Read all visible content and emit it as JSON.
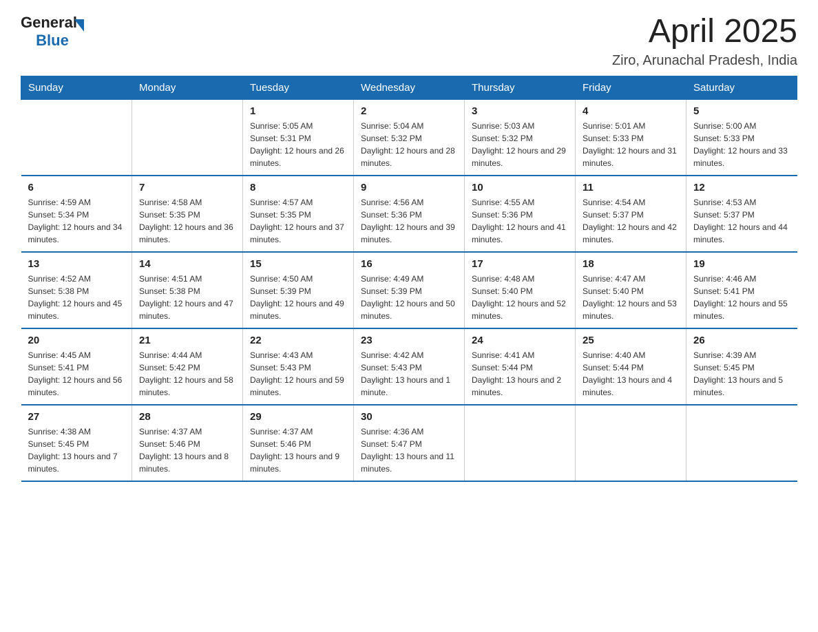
{
  "logo": {
    "general": "General",
    "blue": "Blue"
  },
  "title": "April 2025",
  "subtitle": "Ziro, Arunachal Pradesh, India",
  "days_header": [
    "Sunday",
    "Monday",
    "Tuesday",
    "Wednesday",
    "Thursday",
    "Friday",
    "Saturday"
  ],
  "weeks": [
    [
      {
        "day": "",
        "sunrise": "",
        "sunset": "",
        "daylight": ""
      },
      {
        "day": "",
        "sunrise": "",
        "sunset": "",
        "daylight": ""
      },
      {
        "day": "1",
        "sunrise": "Sunrise: 5:05 AM",
        "sunset": "Sunset: 5:31 PM",
        "daylight": "Daylight: 12 hours and 26 minutes."
      },
      {
        "day": "2",
        "sunrise": "Sunrise: 5:04 AM",
        "sunset": "Sunset: 5:32 PM",
        "daylight": "Daylight: 12 hours and 28 minutes."
      },
      {
        "day": "3",
        "sunrise": "Sunrise: 5:03 AM",
        "sunset": "Sunset: 5:32 PM",
        "daylight": "Daylight: 12 hours and 29 minutes."
      },
      {
        "day": "4",
        "sunrise": "Sunrise: 5:01 AM",
        "sunset": "Sunset: 5:33 PM",
        "daylight": "Daylight: 12 hours and 31 minutes."
      },
      {
        "day": "5",
        "sunrise": "Sunrise: 5:00 AM",
        "sunset": "Sunset: 5:33 PM",
        "daylight": "Daylight: 12 hours and 33 minutes."
      }
    ],
    [
      {
        "day": "6",
        "sunrise": "Sunrise: 4:59 AM",
        "sunset": "Sunset: 5:34 PM",
        "daylight": "Daylight: 12 hours and 34 minutes."
      },
      {
        "day": "7",
        "sunrise": "Sunrise: 4:58 AM",
        "sunset": "Sunset: 5:35 PM",
        "daylight": "Daylight: 12 hours and 36 minutes."
      },
      {
        "day": "8",
        "sunrise": "Sunrise: 4:57 AM",
        "sunset": "Sunset: 5:35 PM",
        "daylight": "Daylight: 12 hours and 37 minutes."
      },
      {
        "day": "9",
        "sunrise": "Sunrise: 4:56 AM",
        "sunset": "Sunset: 5:36 PM",
        "daylight": "Daylight: 12 hours and 39 minutes."
      },
      {
        "day": "10",
        "sunrise": "Sunrise: 4:55 AM",
        "sunset": "Sunset: 5:36 PM",
        "daylight": "Daylight: 12 hours and 41 minutes."
      },
      {
        "day": "11",
        "sunrise": "Sunrise: 4:54 AM",
        "sunset": "Sunset: 5:37 PM",
        "daylight": "Daylight: 12 hours and 42 minutes."
      },
      {
        "day": "12",
        "sunrise": "Sunrise: 4:53 AM",
        "sunset": "Sunset: 5:37 PM",
        "daylight": "Daylight: 12 hours and 44 minutes."
      }
    ],
    [
      {
        "day": "13",
        "sunrise": "Sunrise: 4:52 AM",
        "sunset": "Sunset: 5:38 PM",
        "daylight": "Daylight: 12 hours and 45 minutes."
      },
      {
        "day": "14",
        "sunrise": "Sunrise: 4:51 AM",
        "sunset": "Sunset: 5:38 PM",
        "daylight": "Daylight: 12 hours and 47 minutes."
      },
      {
        "day": "15",
        "sunrise": "Sunrise: 4:50 AM",
        "sunset": "Sunset: 5:39 PM",
        "daylight": "Daylight: 12 hours and 49 minutes."
      },
      {
        "day": "16",
        "sunrise": "Sunrise: 4:49 AM",
        "sunset": "Sunset: 5:39 PM",
        "daylight": "Daylight: 12 hours and 50 minutes."
      },
      {
        "day": "17",
        "sunrise": "Sunrise: 4:48 AM",
        "sunset": "Sunset: 5:40 PM",
        "daylight": "Daylight: 12 hours and 52 minutes."
      },
      {
        "day": "18",
        "sunrise": "Sunrise: 4:47 AM",
        "sunset": "Sunset: 5:40 PM",
        "daylight": "Daylight: 12 hours and 53 minutes."
      },
      {
        "day": "19",
        "sunrise": "Sunrise: 4:46 AM",
        "sunset": "Sunset: 5:41 PM",
        "daylight": "Daylight: 12 hours and 55 minutes."
      }
    ],
    [
      {
        "day": "20",
        "sunrise": "Sunrise: 4:45 AM",
        "sunset": "Sunset: 5:41 PM",
        "daylight": "Daylight: 12 hours and 56 minutes."
      },
      {
        "day": "21",
        "sunrise": "Sunrise: 4:44 AM",
        "sunset": "Sunset: 5:42 PM",
        "daylight": "Daylight: 12 hours and 58 minutes."
      },
      {
        "day": "22",
        "sunrise": "Sunrise: 4:43 AM",
        "sunset": "Sunset: 5:43 PM",
        "daylight": "Daylight: 12 hours and 59 minutes."
      },
      {
        "day": "23",
        "sunrise": "Sunrise: 4:42 AM",
        "sunset": "Sunset: 5:43 PM",
        "daylight": "Daylight: 13 hours and 1 minute."
      },
      {
        "day": "24",
        "sunrise": "Sunrise: 4:41 AM",
        "sunset": "Sunset: 5:44 PM",
        "daylight": "Daylight: 13 hours and 2 minutes."
      },
      {
        "day": "25",
        "sunrise": "Sunrise: 4:40 AM",
        "sunset": "Sunset: 5:44 PM",
        "daylight": "Daylight: 13 hours and 4 minutes."
      },
      {
        "day": "26",
        "sunrise": "Sunrise: 4:39 AM",
        "sunset": "Sunset: 5:45 PM",
        "daylight": "Daylight: 13 hours and 5 minutes."
      }
    ],
    [
      {
        "day": "27",
        "sunrise": "Sunrise: 4:38 AM",
        "sunset": "Sunset: 5:45 PM",
        "daylight": "Daylight: 13 hours and 7 minutes."
      },
      {
        "day": "28",
        "sunrise": "Sunrise: 4:37 AM",
        "sunset": "Sunset: 5:46 PM",
        "daylight": "Daylight: 13 hours and 8 minutes."
      },
      {
        "day": "29",
        "sunrise": "Sunrise: 4:37 AM",
        "sunset": "Sunset: 5:46 PM",
        "daylight": "Daylight: 13 hours and 9 minutes."
      },
      {
        "day": "30",
        "sunrise": "Sunrise: 4:36 AM",
        "sunset": "Sunset: 5:47 PM",
        "daylight": "Daylight: 13 hours and 11 minutes."
      },
      {
        "day": "",
        "sunrise": "",
        "sunset": "",
        "daylight": ""
      },
      {
        "day": "",
        "sunrise": "",
        "sunset": "",
        "daylight": ""
      },
      {
        "day": "",
        "sunrise": "",
        "sunset": "",
        "daylight": ""
      }
    ]
  ]
}
